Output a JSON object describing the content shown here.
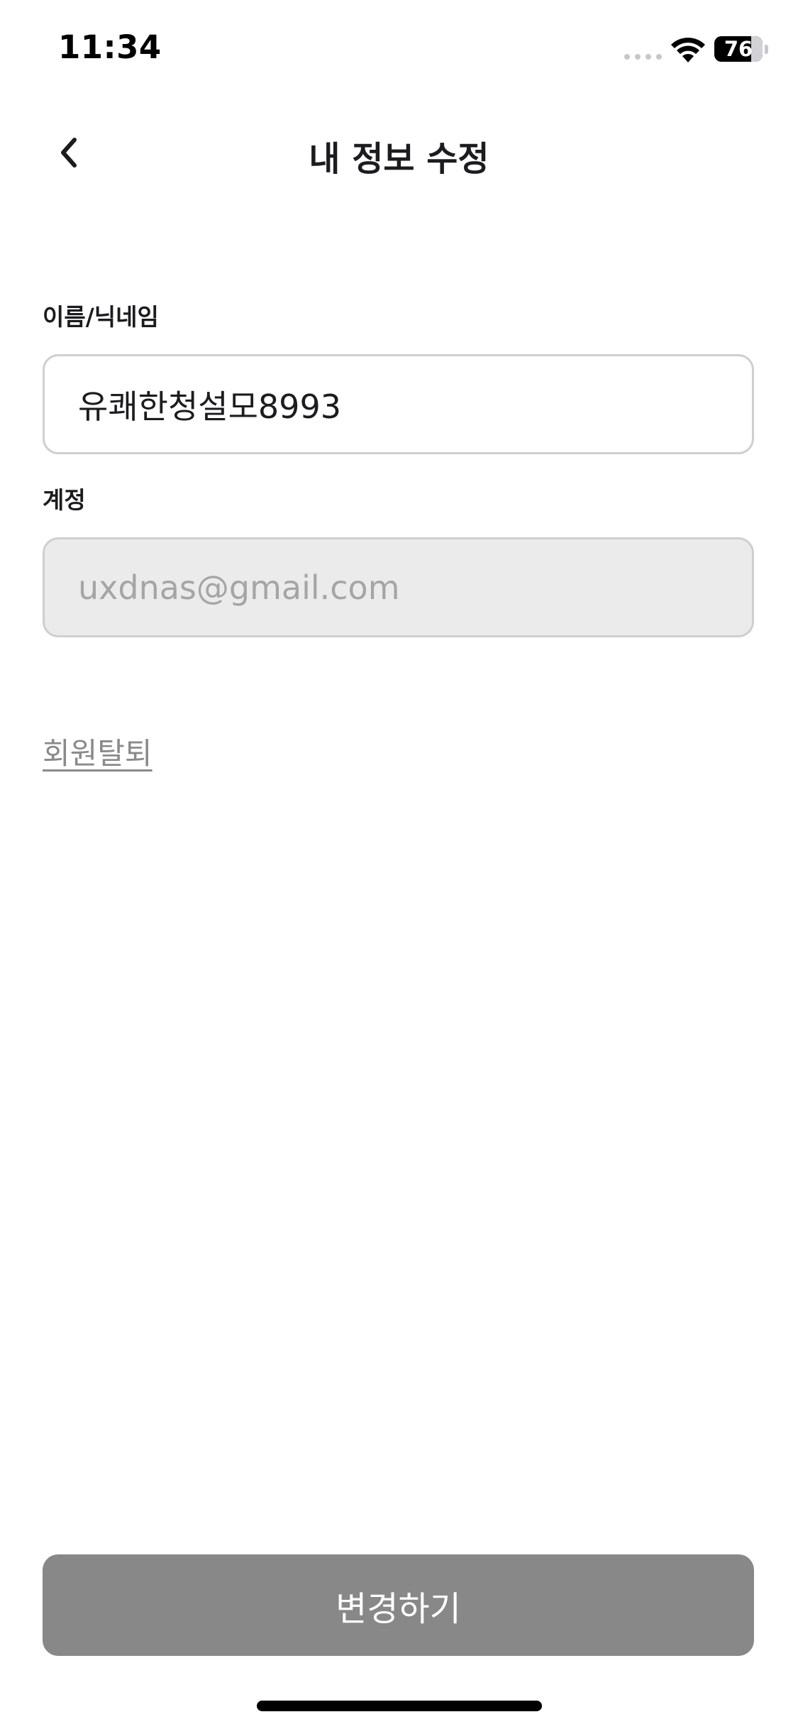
{
  "status_bar": {
    "time": "11:34",
    "battery": "76",
    "battery_level_percent": 76,
    "signal_icon": "cellular-signal-icon",
    "wifi_icon": "wifi-icon",
    "battery_icon": "battery-icon"
  },
  "nav": {
    "back_icon": "chevron-left-icon",
    "title": "내 정보 수정"
  },
  "form": {
    "name_label": "이름/닉네임",
    "name_value": "유쾌한청설모8993",
    "account_label": "계정",
    "account_value": "uxdnas@gmail.com"
  },
  "withdraw_label": "회원탈퇴",
  "submit_label": "변경하기",
  "colors": {
    "button_disabled": "#888888",
    "field_border": "#cfcfcf",
    "field_disabled_bg": "#ebebeb",
    "link": "#8a8a8a"
  }
}
